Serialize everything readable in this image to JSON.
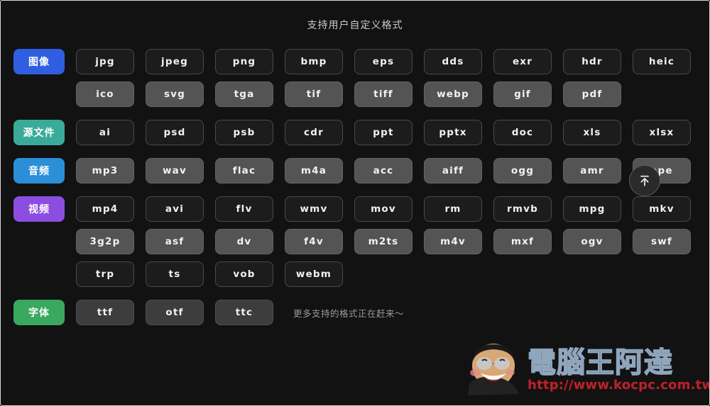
{
  "header": {
    "title": "支持用户自定义格式"
  },
  "colors": {
    "background": "#121212",
    "chip_dark": "#1c1c1c",
    "chip_light": "#545454",
    "chip_mid": "#3d3d3d",
    "badge_image": "#2f5fe0",
    "badge_source": "#3aab9b",
    "badge_audio": "#2b8fd8",
    "badge_video": "#8b4ee0",
    "badge_font": "#3aa85f",
    "watermark_url": "#b7232b",
    "watermark_brand": "#1d3a57"
  },
  "groups": [
    {
      "name": "image",
      "badge": {
        "label": "图像",
        "color": "#2f5fe0"
      },
      "rows": [
        {
          "style": "dark",
          "formats": [
            "jpg",
            "jpeg",
            "png",
            "bmp",
            "eps",
            "dds",
            "exr",
            "hdr",
            "heic"
          ]
        },
        {
          "style": "light",
          "formats": [
            "ico",
            "svg",
            "tga",
            "tif",
            "tiff",
            "webp",
            "gif",
            "pdf"
          ]
        }
      ]
    },
    {
      "name": "source-file",
      "badge": {
        "label": "源文件",
        "color": "#3aab9b"
      },
      "rows": [
        {
          "style": "dark",
          "formats": [
            "ai",
            "psd",
            "psb",
            "cdr",
            "ppt",
            "pptx",
            "doc",
            "xls",
            "xlsx"
          ]
        }
      ]
    },
    {
      "name": "audio",
      "badge": {
        "label": "音频",
        "color": "#2b8fd8"
      },
      "rows": [
        {
          "style": "light",
          "formats": [
            "mp3",
            "wav",
            "flac",
            "m4a",
            "acc",
            "aiff",
            "ogg",
            "amr",
            "ape"
          ]
        }
      ]
    },
    {
      "name": "video",
      "badge": {
        "label": "视频",
        "color": "#8b4ee0"
      },
      "rows": [
        {
          "style": "dark",
          "formats": [
            "mp4",
            "avi",
            "flv",
            "wmv",
            "mov",
            "rm",
            "rmvb",
            "mpg",
            "mkv"
          ]
        },
        {
          "style": "light",
          "formats": [
            "3g2p",
            "asf",
            "dv",
            "f4v",
            "m2ts",
            "m4v",
            "mxf",
            "ogv",
            "swf"
          ]
        },
        {
          "style": "dark",
          "formats": [
            "trp",
            "ts",
            "vob",
            "webm"
          ]
        }
      ]
    },
    {
      "name": "font",
      "badge": {
        "label": "字体",
        "color": "#3aa85f"
      },
      "rows": [
        {
          "style": "mid",
          "formats": [
            "ttf",
            "otf",
            "ttc"
          ],
          "note": "更多支持的格式正在赶来～"
        }
      ]
    }
  ],
  "scroll_top_button": {
    "icon": "arrow-up-to-line-icon",
    "label": "回到顶部"
  },
  "watermark": {
    "brand": "電腦王阿達",
    "url": "http://www.kocpc.com.tw"
  }
}
